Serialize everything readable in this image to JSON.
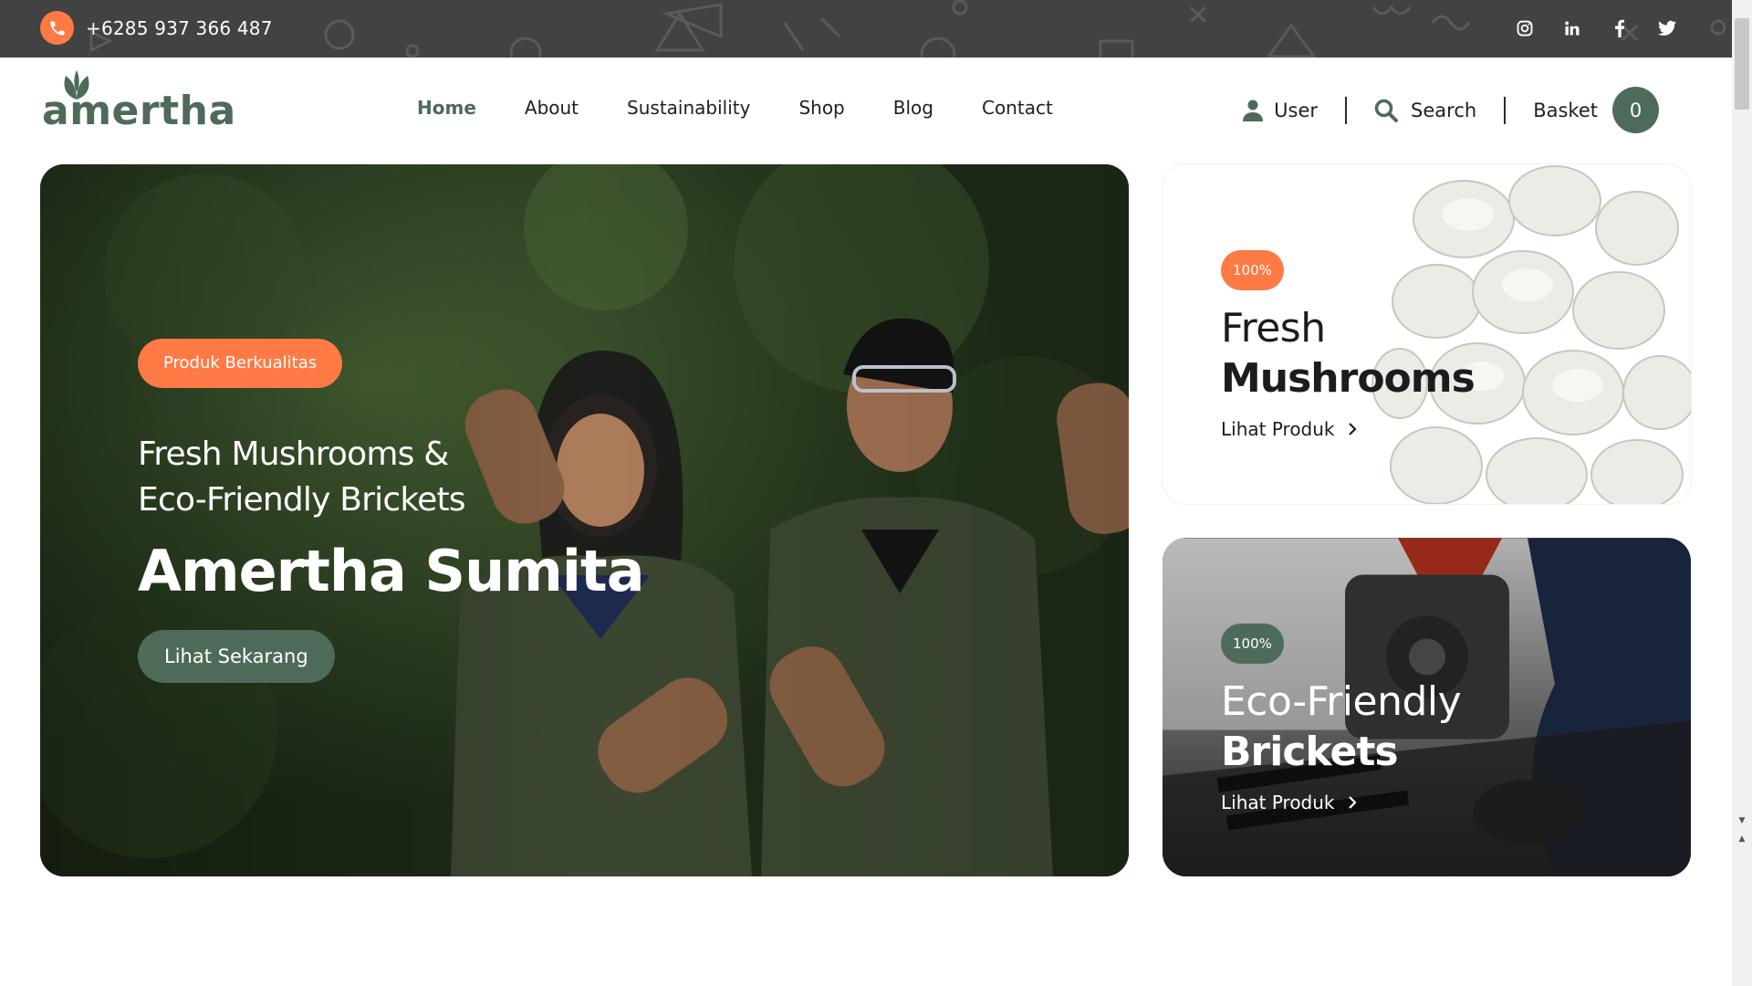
{
  "topbar": {
    "phone": "+6285 937 366 487",
    "socials": [
      "instagram-icon",
      "linkedin-icon",
      "facebook-icon",
      "twitter-icon"
    ]
  },
  "brand": {
    "name": "amertha"
  },
  "nav": {
    "items": [
      "Home",
      "About",
      "Sustainability",
      "Shop",
      "Blog",
      "Contact"
    ],
    "active": "Home"
  },
  "header": {
    "user_label": "User",
    "search_label": "Search",
    "basket_label": "Basket",
    "basket_count": "0"
  },
  "hero": {
    "badge": "Produk Berkualitas",
    "subtitle_line1": "Fresh Mushrooms &",
    "subtitle_line2": "Eco-Friendly Brickets",
    "title": "Amertha Sumita",
    "cta": "Lihat Sekarang"
  },
  "cards": [
    {
      "badge": "100%",
      "line1": "Fresh",
      "line2": "Mushrooms",
      "link": "Lihat Produk"
    },
    {
      "badge": "100%",
      "line1": "Eco-Friendly",
      "line2": "Brickets",
      "link": "Lihat Produk"
    }
  ],
  "colors": {
    "topbar_bg": "#424242",
    "accent_orange": "#ff7a45",
    "brand_green": "#4e6a59"
  }
}
